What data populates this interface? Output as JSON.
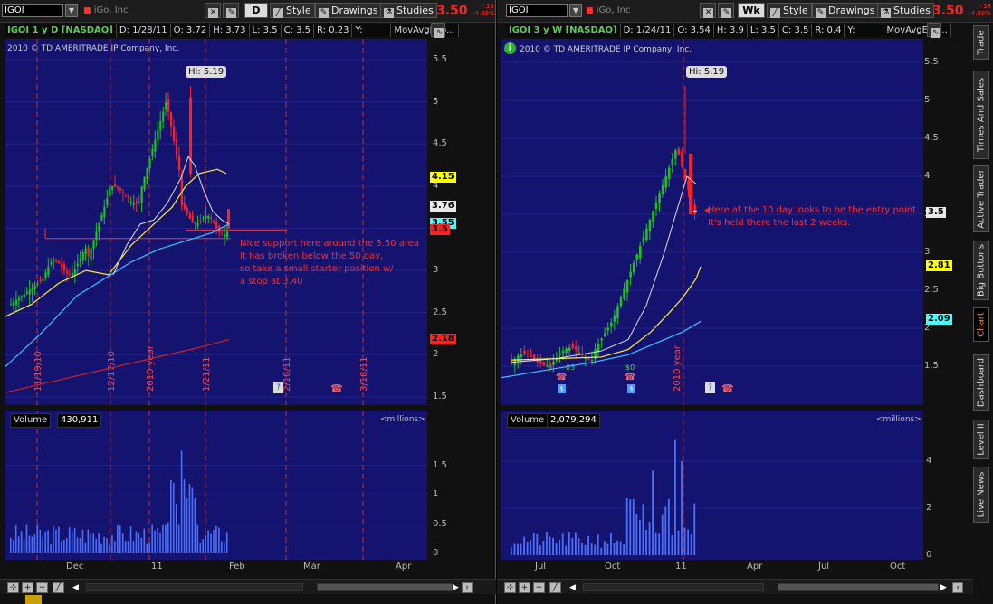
{
  "left": {
    "symbol": "IGOI",
    "company": "iGo, Inc",
    "period_button": "D",
    "style_label": "Style",
    "drawings_label": "Drawings",
    "studies_label": "Studies",
    "price": "3.50",
    "change_abs": "-.18",
    "change_pct": "-4.89%",
    "info": {
      "title": "IGOI 1 y D [NASDAQ]",
      "date": "D: 1/28/11",
      "open": "O: 3.72",
      "high": "H: 3.73",
      "low": "L: 3.5",
      "close": "C: 3.5",
      "range": "R: 0.23",
      "y": "Y:",
      "study": "MovAvgExp..."
    },
    "copyright": "2010 © TD AMERITRADE IP Company, Inc.",
    "y_axis": [
      "5.5",
      "5",
      "4.5",
      "4",
      "3.5",
      "3",
      "2.5",
      "2",
      "1.5"
    ],
    "badges": [
      {
        "text": "4.15",
        "bg": "#ffff00",
        "fg": "#000000"
      },
      {
        "text": "3.76",
        "bg": "#e8e8e8",
        "fg": "#000000"
      },
      {
        "text": "3.55",
        "bg": "#40ffff",
        "fg": "#000000"
      },
      {
        "text": "3.5",
        "bg": "#ff2020",
        "fg": "#000000"
      },
      {
        "text": "2.18",
        "bg": "#ff2020",
        "fg": "#000000"
      }
    ],
    "hi_label": "Hi: 5.19",
    "date_markers": [
      "11/19/10",
      "12/17/10",
      "2010 year",
      "1/21/11",
      "2/18/11",
      "3/18/11"
    ],
    "annotation": [
      "Nice support here around the 3.50 area",
      "It has broken below the 50 day,",
      "so take a small starter position w/",
      "a stop at 3.40"
    ],
    "volume_label": "Volume",
    "volume_value": "430,911",
    "millions_label": "<millions>",
    "vol_axis": [
      "1.5",
      "1",
      "0.5",
      "0"
    ],
    "x_axis": [
      "Dec",
      "11",
      "Feb",
      "Mar",
      "Apr"
    ]
  },
  "right": {
    "symbol": "IGOI",
    "company": "iGo, Inc",
    "period_button": "Wk",
    "style_label": "Style",
    "drawings_label": "Drawings",
    "studies_label": "Studies",
    "price": "3.50",
    "change_abs": "-.18",
    "change_pct": "-4.89%",
    "info": {
      "title": "IGOI 3 y W [NASDAQ]",
      "date": "D: 1/24/11",
      "open": "O: 3.54",
      "high": "H: 3.9",
      "low": "L: 3.5",
      "close": "C: 3.5",
      "range": "R: 0.4",
      "y": "Y:",
      "study": "MovAvgExp..."
    },
    "copyright": "2010 © TD AMERITRADE IP Company, Inc.",
    "y_axis": [
      "5.5",
      "5",
      "4.5",
      "4",
      "3.5",
      "3",
      "2.5",
      "2",
      "1.5"
    ],
    "badges": [
      {
        "text": "3.5",
        "bg": "#e8e8e8",
        "fg": "#000000"
      },
      {
        "text": "2.81",
        "bg": "#ffff00",
        "fg": "#000000"
      },
      {
        "text": "2.09",
        "bg": "#40ffff",
        "fg": "#000000"
      }
    ],
    "hi_label": "Hi: 5.19",
    "date_markers": [
      "2010 year"
    ],
    "div_labels": [
      "0",
      "03",
      "$0"
    ],
    "annotation": [
      "Here at the 10 day looks to be the entry point.",
      "It's held there the last 2 weeks."
    ],
    "volume_label": "Volume",
    "volume_value": "2,079,294",
    "millions_label": "<millions>",
    "vol_axis": [
      "4",
      "2",
      "0"
    ],
    "x_axis": [
      "Jul",
      "Oct",
      "11",
      "Apr",
      "Jul",
      "Oct"
    ]
  },
  "side_tabs": [
    "Trade",
    "Times And Sales",
    "Active Trader",
    "Big Buttons",
    "Chart",
    "Dashboard",
    "Level II",
    "Live News"
  ],
  "active_tab": "Chart",
  "colors": {
    "chart_bg": "#141470",
    "price_red": "#ff2020",
    "up_green": "#20c020",
    "sma_yellow": "#ffee33",
    "sma_cyan": "#40c0ff",
    "sma_white": "#dddddd",
    "sma_red": "#d02020"
  }
}
